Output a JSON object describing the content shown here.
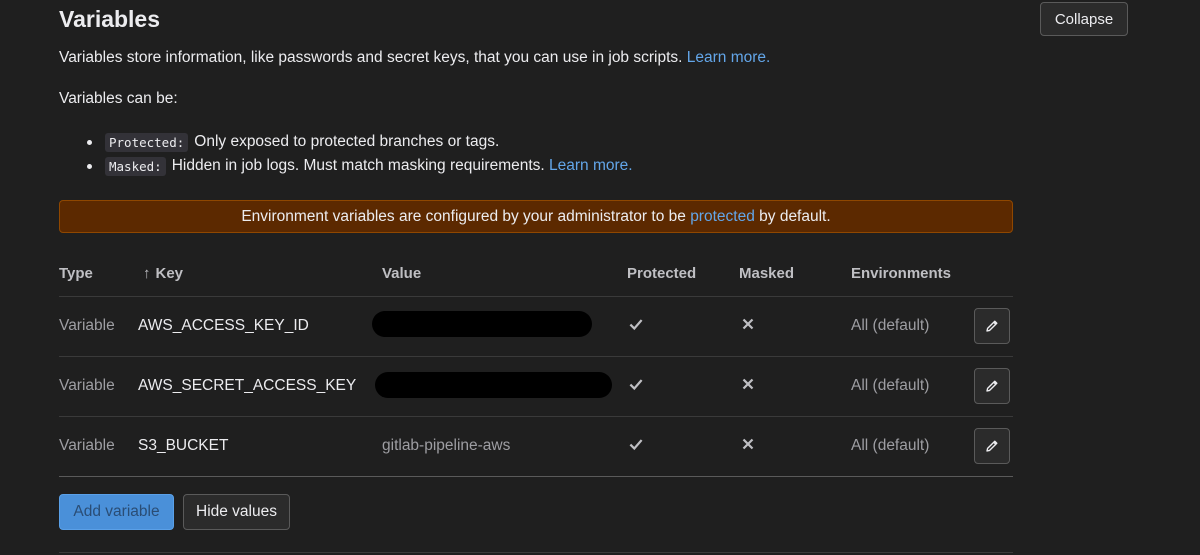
{
  "section": {
    "title": "Variables",
    "collapse_label": "Collapse",
    "description": "Variables store information, like passwords and secret keys, that you can use in job scripts.",
    "learn_more": "Learn more.",
    "can_be": "Variables can be:",
    "bullets": [
      {
        "code": "Protected:",
        "text": "Only exposed to protected branches or tags.",
        "link": ""
      },
      {
        "code": "Masked:",
        "text": "Hidden in job logs. Must match masking requirements.",
        "link": "Learn more."
      }
    ]
  },
  "alert": {
    "before": "Environment variables are configured by your administrator to be",
    "link": "protected",
    "after": "by default.",
    "color": "#5c2900"
  },
  "table": {
    "headers": {
      "type": "Type",
      "key": "Key",
      "value": "Value",
      "protected": "Protected",
      "masked": "Masked",
      "environments": "Environments"
    },
    "sort_icon": "arrow-up-icon",
    "rows": [
      {
        "type": "Variable",
        "key": "AWS_ACCESS_KEY_ID",
        "value": "",
        "value_hidden": true,
        "protected": true,
        "masked": false,
        "environment": "All (default)"
      },
      {
        "type": "Variable",
        "key": "AWS_SECRET_ACCESS_KEY",
        "value": "",
        "value_hidden": true,
        "protected": true,
        "masked": false,
        "environment": "All (default)"
      },
      {
        "type": "Variable",
        "key": "S3_BUCKET",
        "value": "gitlab-pipeline-aws",
        "value_hidden": false,
        "protected": true,
        "masked": false,
        "environment": "All (default)"
      }
    ]
  },
  "actions": {
    "add_label": "Add variable",
    "hide_label": "Hide values",
    "accent": "#4a90d9"
  }
}
